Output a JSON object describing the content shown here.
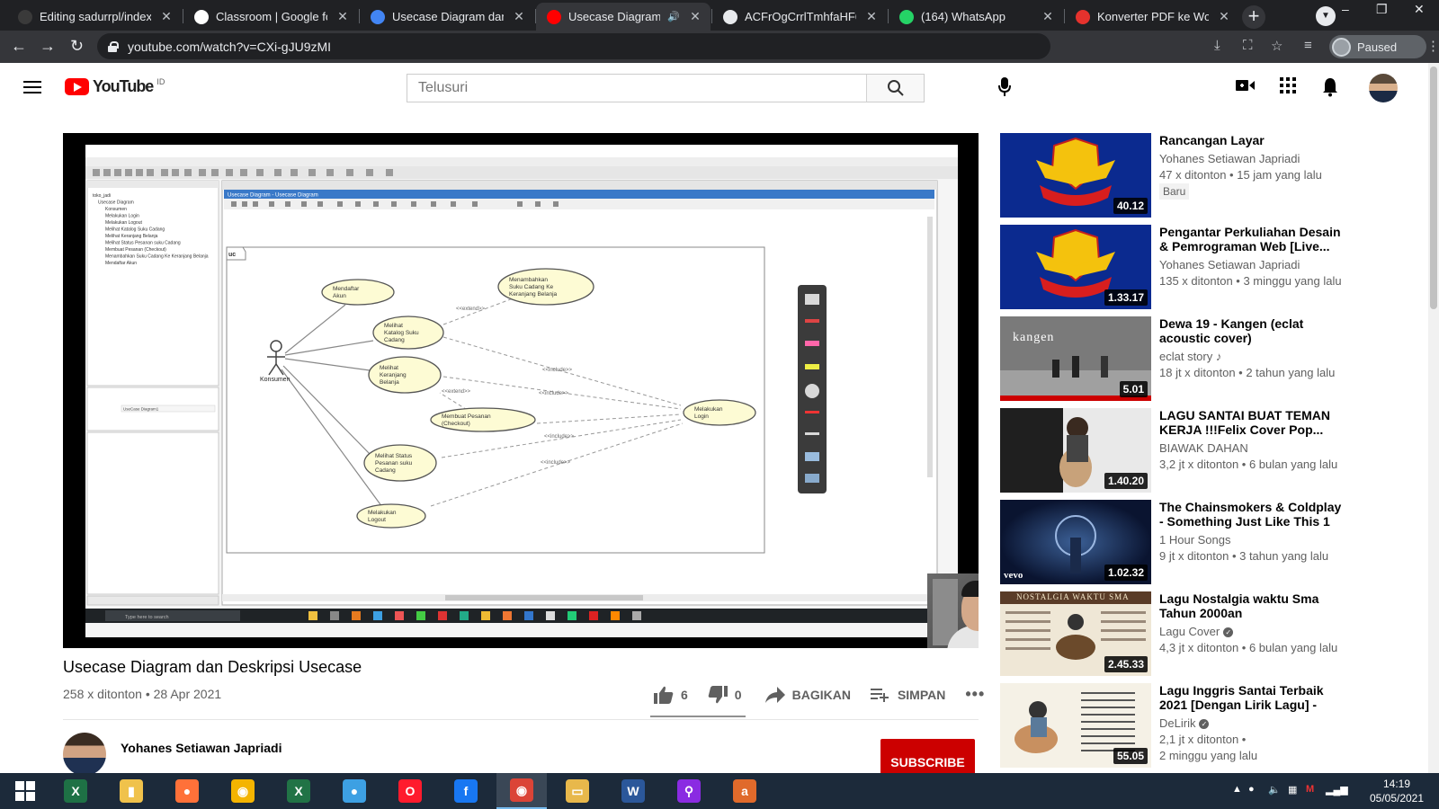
{
  "browser": {
    "tabs": [
      {
        "title": "Editing sadurrpl/index.ht",
        "favicon": "github-icon",
        "color": "#3a3a3a"
      },
      {
        "title": "Classroom | Google for E",
        "favicon": "google-icon",
        "color": "#ffffff"
      },
      {
        "title": "Usecase Diagram dan De",
        "favicon": "docs-icon",
        "color": "#4285f4"
      },
      {
        "title": "Usecase Diagram da",
        "favicon": "youtube-icon",
        "color": "#ff0000",
        "active": true
      },
      {
        "title": "ACFrOgCrrlTmhfaHF6Vr",
        "favicon": "globe-icon",
        "color": "#e8eaed"
      },
      {
        "title": "(164) WhatsApp",
        "favicon": "whatsapp-icon",
        "color": "#25d366"
      },
      {
        "title": "Konverter PDF ke Word",
        "favicon": "ilovepdf-icon",
        "color": "#e5322d"
      }
    ],
    "url": "youtube.com/watch?v=CXi-gJU9zMI",
    "profile_status": "Paused",
    "window_controls": [
      "–",
      "❐",
      "✕"
    ]
  },
  "youtube": {
    "logo_text": "YouTube",
    "region": "ID",
    "search_placeholder": "Telusuri",
    "video": {
      "title": "Usecase Diagram dan Deskripsi Usecase",
      "meta": "258 x ditonton • 28 Apr 2021",
      "likes": "6",
      "dislikes": "0",
      "share_label": "BAGIKAN",
      "save_label": "SIMPAN",
      "like_ratio": 1.0
    },
    "channel": {
      "name": "Yohanes Setiawan Japriadi",
      "subscribe_label": "SUBSCRIBE"
    },
    "recommendations": [
      {
        "title": "Rancangan Layar",
        "channel": "Yohanes Setiawan Japriadi",
        "views": "47 x ditonton • 15 jam yang lalu",
        "badge": "Baru",
        "duration": "40.12",
        "thumb": "isb"
      },
      {
        "title": "Pengantar Perkuliahan Desain & Pemrograman Web [Live...",
        "channel": "Yohanes Setiawan Japriadi",
        "views": "135 x ditonton • 3 minggu yang lalu",
        "duration": "1.33.17",
        "thumb": "isb"
      },
      {
        "title": "Dewa 19 - Kangen (eclat acoustic cover)",
        "channel": "eclat story",
        "views": "18 jt x ditonton • 2 tahun yang lalu",
        "duration": "5.01",
        "thumb": "kangen",
        "thumb_text": "kangen"
      },
      {
        "title": "LAGU SANTAI BUAT TEMAN KERJA !!!Felix Cover Pop...",
        "channel": "BIAWAK DAHAN",
        "views": "3,2 jt x ditonton • 6 bulan yang lalu",
        "duration": "1.40.20",
        "thumb": "lagu"
      },
      {
        "title": "The Chainsmokers & Coldplay - Something Just Like This 1 ho...",
        "channel": "1 Hour Songs",
        "views": "9 jt x ditonton • 3 tahun yang lalu",
        "duration": "1.02.32",
        "thumb": "cs",
        "thumb_text": "vevo"
      },
      {
        "title": "Lagu Nostalgia waktu Sma Tahun 2000an",
        "channel": "Lagu Cover",
        "views": "4,3 jt x ditonton • 6 bulan yang lalu",
        "duration": "2.45.33",
        "thumb": "nost",
        "thumb_text": "NOSTALGIA WAKTU SMA",
        "verified": true
      },
      {
        "title": "Lagu Inggris Santai Terbaik 2021 [Dengan Lirik Lagu] - Lag...",
        "channel": "DeLirik",
        "views": "2,1 jt x ditonton •",
        "views2": "2 minggu yang lalu",
        "duration": "55.05",
        "thumb": "ing",
        "verified": true
      }
    ]
  },
  "diagram": {
    "boundary_label": "uc",
    "actor": "Konsumen",
    "usecases": [
      {
        "id": "daftar",
        "label1": "Mendaftar",
        "label2": "Akun"
      },
      {
        "id": "katalog",
        "label1": "Melihat",
        "label2": "Katalog Suku",
        "label3": "Cadang"
      },
      {
        "id": "keranjang",
        "label1": "Melihat",
        "label2": "Keranjang",
        "label3": "Belanja"
      },
      {
        "id": "tambah",
        "label1": "Menambahkan",
        "label2": "Suku Cadang Ke",
        "label3": "Keranjang Belanja"
      },
      {
        "id": "pesan",
        "label1": "Membuat Pesanan",
        "label2": "(Checkout)"
      },
      {
        "id": "status",
        "label1": "Melihat Status",
        "label2": "Pesanan suku",
        "label3": "Cadang"
      },
      {
        "id": "logout",
        "label1": "Melakukan",
        "label2": "Logout"
      },
      {
        "id": "login",
        "label1": "Melakukan",
        "label2": "Login"
      }
    ],
    "relations": [
      "<<extend>>",
      "<<include>>",
      "<<extend>>",
      "<<include>>",
      "<<include>>",
      "<<include>>"
    ],
    "app_title": "Usecase Diagram - Usecase Diagram",
    "tree": [
      "toko_jadi",
      "Usecase Diagram",
      "Konsumen",
      "Melakukan Login",
      "Melakukan Logout",
      "Melihat Katalog Suku Cadang",
      "Melihat Keranjang Belanja",
      "Melihat Status Pesanan suku Cadang",
      "Membuat Pesanan (Checkout)",
      "Menambahkan Suku Cadang Ke Keranjang Belanja",
      "Mendaftar Akun"
    ],
    "props_value": "UseCase Diagram1",
    "search_hint": "Type here to search"
  },
  "taskbar": {
    "apps": [
      {
        "name": "excel-icon",
        "color": "#1e7145",
        "glyph": "X"
      },
      {
        "name": "file-explorer-icon",
        "color": "#f0c24b",
        "glyph": "▮"
      },
      {
        "name": "firefox-icon",
        "color": "#ff7139",
        "glyph": "●"
      },
      {
        "name": "chrome-canary-icon",
        "color": "#f4b400",
        "glyph": "◉"
      },
      {
        "name": "excel-file-icon",
        "color": "#217346",
        "glyph": "X"
      },
      {
        "name": "browser-icon",
        "color": "#3da0e3",
        "glyph": "●"
      },
      {
        "name": "opera-icon",
        "color": "#ff1b2d",
        "glyph": "O"
      },
      {
        "name": "facebook-icon",
        "color": "#1877f2",
        "glyph": "f"
      },
      {
        "name": "chrome-icon",
        "color": "#db4437",
        "glyph": "◉",
        "active": true
      },
      {
        "name": "folder-icon",
        "color": "#e8b84b",
        "glyph": "▭"
      },
      {
        "name": "word-icon",
        "color": "#2b579a",
        "glyph": "W"
      },
      {
        "name": "search-app-icon",
        "color": "#8a2be2",
        "glyph": "⚲"
      },
      {
        "name": "ash-icon",
        "color": "#e06a2b",
        "glyph": "a"
      }
    ],
    "time": "14:19",
    "date": "05/05/2021"
  }
}
